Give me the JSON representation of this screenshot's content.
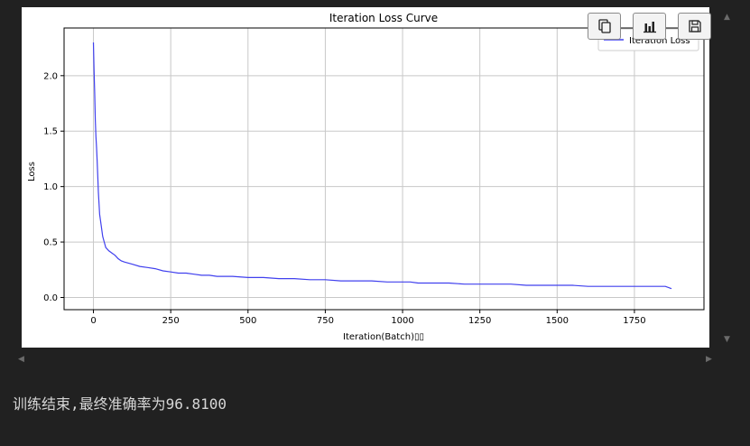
{
  "output": {
    "status_text": "训练结束,最终准确率为96.8100"
  },
  "toolbar": {
    "buttons": [
      {
        "name": "copy",
        "icon": "copy-icon"
      },
      {
        "name": "chart",
        "icon": "bar-chart-icon"
      },
      {
        "name": "save",
        "icon": "save-icon"
      }
    ]
  },
  "colors": {
    "page_background": "#212121",
    "plot_background": "#ffffff",
    "series_line": "#4040ee",
    "grid": "#c8c8c8",
    "status_text": "#d6d6d6"
  },
  "chart_data": {
    "type": "line",
    "title": "Iteration Loss Curve",
    "xlabel": "Iteration(Batch)▯▯",
    "ylabel": "Loss",
    "xlim": [
      -95,
      1975
    ],
    "ylim": [
      -0.11,
      2.43
    ],
    "xticks": [
      0,
      250,
      500,
      750,
      1000,
      1250,
      1500,
      1750
    ],
    "yticks": [
      0.0,
      0.5,
      1.0,
      1.5,
      2.0
    ],
    "xtick_labels": [
      "0",
      "250",
      "500",
      "750",
      "1000",
      "1250",
      "1500",
      "1750"
    ],
    "ytick_labels": [
      "0.0",
      "0.5",
      "1.0",
      "1.5",
      "2.0"
    ],
    "grid": true,
    "legend_position": "top-right",
    "series": [
      {
        "name": "Iteration Loss",
        "x": [
          0,
          2,
          4,
          6,
          8,
          10,
          12,
          14,
          16,
          18,
          20,
          25,
          30,
          35,
          40,
          50,
          60,
          70,
          80,
          90,
          100,
          125,
          150,
          175,
          200,
          225,
          250,
          275,
          300,
          325,
          350,
          375,
          400,
          450,
          500,
          550,
          600,
          650,
          700,
          750,
          800,
          850,
          900,
          950,
          1000,
          1025,
          1050,
          1100,
          1150,
          1200,
          1250,
          1300,
          1350,
          1400,
          1450,
          1500,
          1550,
          1600,
          1650,
          1700,
          1750,
          1800,
          1850,
          1870
        ],
        "y": [
          2.3,
          2.05,
          1.85,
          1.6,
          1.45,
          1.35,
          1.24,
          1.1,
          0.95,
          0.85,
          0.75,
          0.65,
          0.55,
          0.5,
          0.45,
          0.42,
          0.4,
          0.38,
          0.35,
          0.33,
          0.32,
          0.3,
          0.28,
          0.27,
          0.26,
          0.24,
          0.23,
          0.22,
          0.22,
          0.21,
          0.2,
          0.2,
          0.19,
          0.19,
          0.18,
          0.18,
          0.17,
          0.17,
          0.16,
          0.16,
          0.15,
          0.15,
          0.15,
          0.14,
          0.14,
          0.14,
          0.13,
          0.13,
          0.13,
          0.12,
          0.12,
          0.12,
          0.12,
          0.11,
          0.11,
          0.11,
          0.11,
          0.1,
          0.1,
          0.1,
          0.1,
          0.1,
          0.1,
          0.08
        ]
      }
    ]
  }
}
